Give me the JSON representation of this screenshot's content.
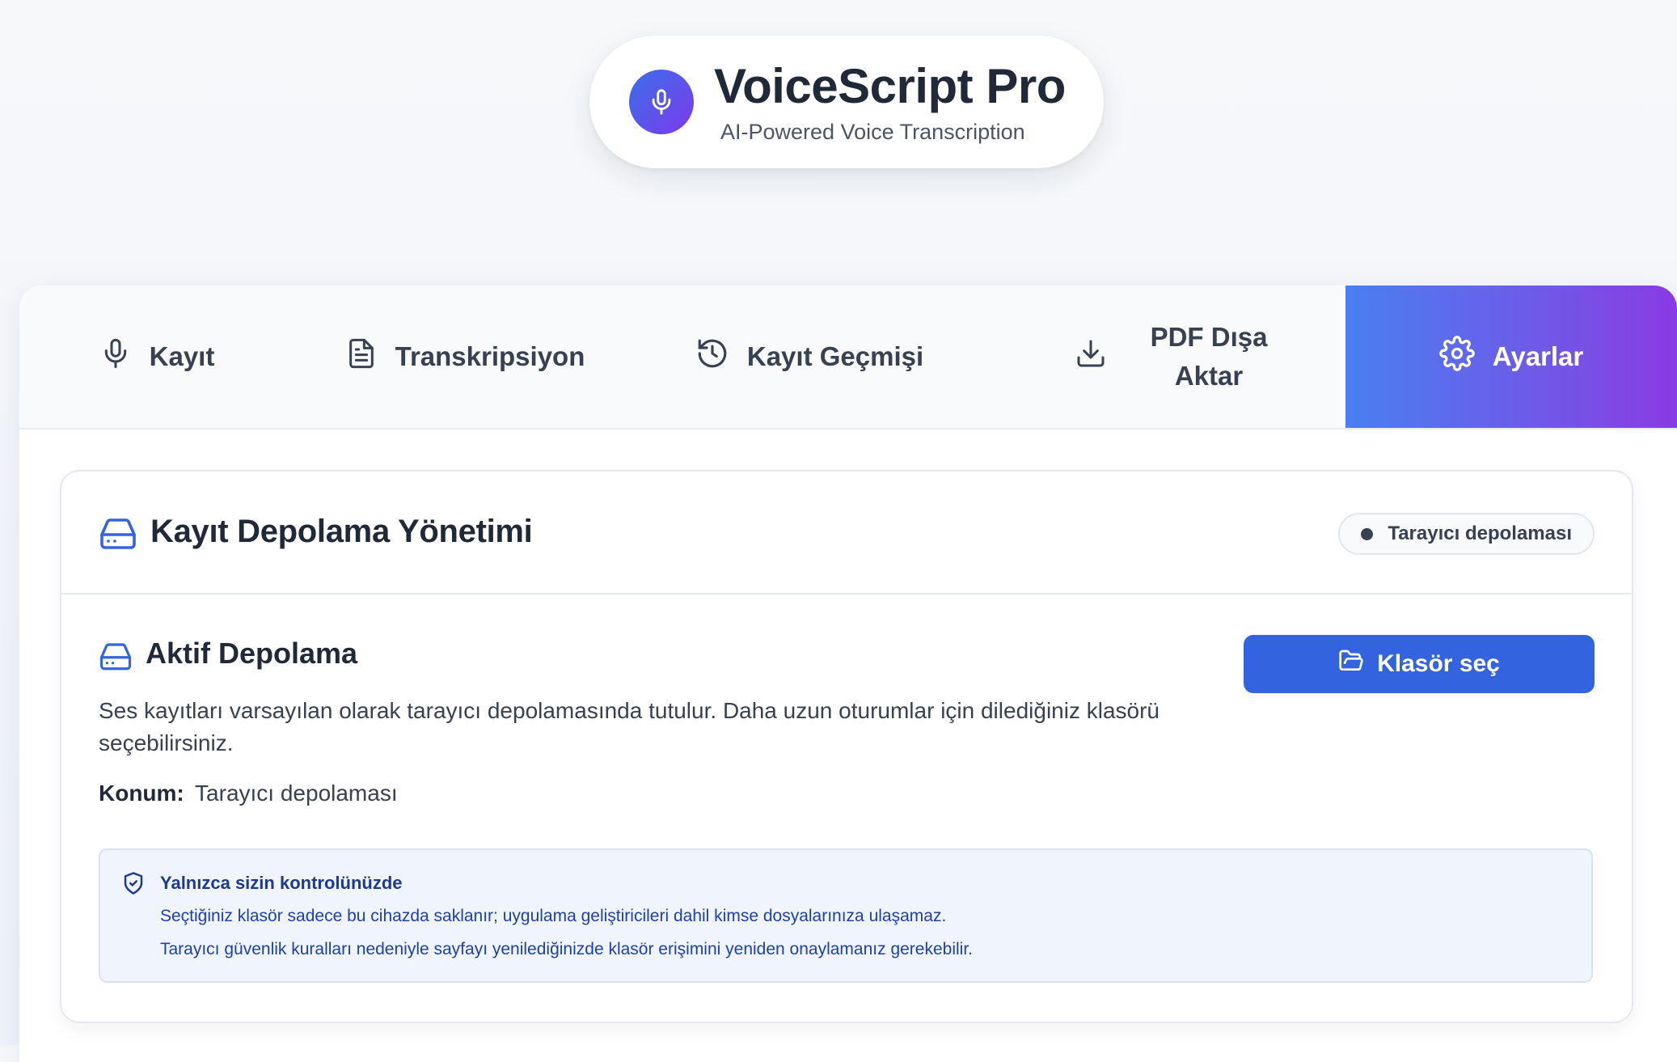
{
  "app": {
    "title": "VoiceScript Pro",
    "subtitle": "AI-Powered Voice Transcription",
    "logo_icon": "microphone-icon"
  },
  "tabs": [
    {
      "label": "Kayıt",
      "icon": "microphone-icon",
      "active": false
    },
    {
      "label": "Transkripsiyon",
      "icon": "document-icon",
      "active": false
    },
    {
      "label": "Kayıt Geçmişi",
      "icon": "history-icon",
      "active": false
    },
    {
      "label": "PDF Dışa Aktar",
      "icon": "download-icon",
      "active": false
    },
    {
      "label": "Ayarlar",
      "icon": "gear-icon",
      "active": true
    }
  ],
  "storage": {
    "title": "Kayıt Depolama Yönetimi",
    "badge": "Tarayıcı depolaması",
    "section_title": "Aktif Depolama",
    "description": "Ses kayıtları varsayılan olarak tarayıcı depolamasında tutulur. Daha uzun oturumlar için dilediğiniz klasörü seçebilirsiniz.",
    "location_label": "Konum:",
    "location_value": "Tarayıcı depolaması",
    "choose_button": "Klasör seç"
  },
  "notice": {
    "title": "Yalnızca sizin kontrolünüzde",
    "line1": "Seçtiğiniz klasör sadece bu cihazda saklanır; uygulama geliştiricileri dahil kimse dosyalarınıza ulaşamaz.",
    "line2": "Tarayıcı güvenlik kuralları nedeniyle sayfayı yenilediğinizde klasör erişimini yeniden onaylamanız gerekebilir."
  },
  "colors": {
    "accent": "#3463e0",
    "gradient_start": "#4a7ff0",
    "gradient_end": "#8a3be3",
    "notice_bg": "#eff4fd",
    "notice_text": "#1e40af"
  }
}
